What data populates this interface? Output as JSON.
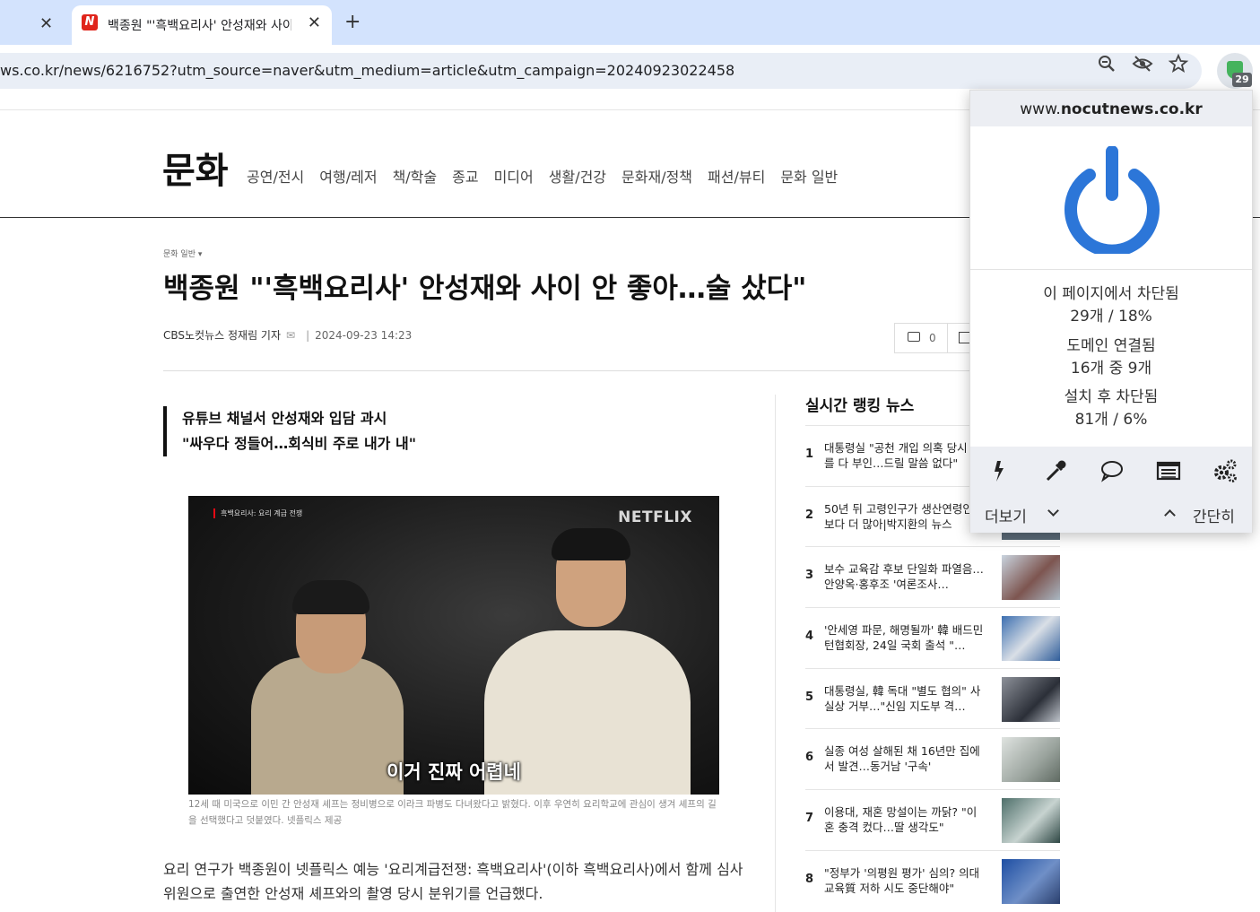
{
  "browser": {
    "tabs": [
      {
        "title": "",
        "active": false
      },
      {
        "title": "백종원 \"'흑백요리사' 안성재와 사이 안 좋아…술 샀다\"",
        "favicon": "N",
        "active": true
      }
    ],
    "new_tab": "+",
    "close_glyph": "✕",
    "url": "ws.co.kr/news/6216752?utm_source=naver&utm_medium=article&utm_campaign=20240923022458",
    "extension_badge": "29"
  },
  "page": {
    "section_title": "문화",
    "section_nav": [
      "공연/전시",
      "여행/레저",
      "책/학술",
      "종교",
      "미디어",
      "생활/건강",
      "문화재/정책",
      "패션/뷰티",
      "문화 일반"
    ],
    "breadcrumb": "문화 일반 ▾",
    "headline": "백종원 \"'흑백요리사' 안성재와 사이 안 좋아…술 샀다\"",
    "byline": {
      "author": "CBS노컷뉴스 정재림 기자",
      "date": "2024-09-23 14:23"
    },
    "comment_count": "0",
    "summary": [
      "유튜브 채널서 안성재와 입담 과시",
      "\"싸우다 정들어…회식비 주로 내가 내\""
    ],
    "photo": {
      "tag": "흑백요리사: 요리 계급 전쟁",
      "brand": "NETFLIX",
      "subtitle": "이거 진짜 어렵네",
      "caption": "12세 때 미국으로 이민 간 안성재 셰프는 정비병으로 이라크 파병도 다녀왔다고 밝혔다. 이후 우연히 요리학교에 관심이 생겨 셰프의 길을 선택했다고 덧붙였다. 넷플릭스 제공"
    },
    "body": "요리 연구가 백종원이 넷플릭스 예능 '요리계급전쟁: 흑백요리사'(이하 흑백요리사)에서 함께 심사위원으로 출연한 안성재 셰프와의 촬영 당시 분위기를 언급했다.",
    "ranking": {
      "title": "실시간 랭킹 뉴스",
      "items": [
        {
          "num": "1",
          "text": "대통령실 \"공천 개입 의혹 당시 자를 다 부인…드릴 말씀 없다\""
        },
        {
          "num": "2",
          "text": "50년 뒤 고령인구가 생산연령인구보다 더 많아|박지환의 뉴스"
        },
        {
          "num": "3",
          "text": "보수 교육감 후보 단일화 파열음…안양옥·홍후조 '여론조사…"
        },
        {
          "num": "4",
          "text": "'안세영 파문, 해명될까' 韓 배드민턴협회장, 24일 국회 출석 \"…"
        },
        {
          "num": "5",
          "text": "대통령실, 韓 독대 \"별도 협의\" 사실상 거부…\"신임 지도부 격…"
        },
        {
          "num": "6",
          "text": "실종 여성 살해된 채 16년만 집에서 발견…동거남 '구속'"
        },
        {
          "num": "7",
          "text": "이용대, 재혼 망설이는 까닭? \"이혼 충격 컸다…딸 생각도\""
        },
        {
          "num": "8",
          "text": "\"정부가 '의평원 평가' 심의? 의대교육質 저하 시도 중단해야\""
        }
      ]
    }
  },
  "popup": {
    "domain_prefix": "www.",
    "domain_bold": "nocutnews.co.kr",
    "accent_color": "#2c76d8",
    "stats": [
      {
        "label": "이 페이지에서 차단됨",
        "value": "29개 / 18%"
      },
      {
        "label": "도메인 연결됨",
        "value": "16개 중 9개"
      },
      {
        "label": "설치 후 차단됨",
        "value": "81개 / 6%"
      }
    ],
    "tools": [
      "lightning-icon",
      "eyedropper-icon",
      "speech-bubble-icon",
      "list-icon",
      "gears-icon"
    ],
    "more_label": "더보기",
    "less_label": "간단히"
  }
}
